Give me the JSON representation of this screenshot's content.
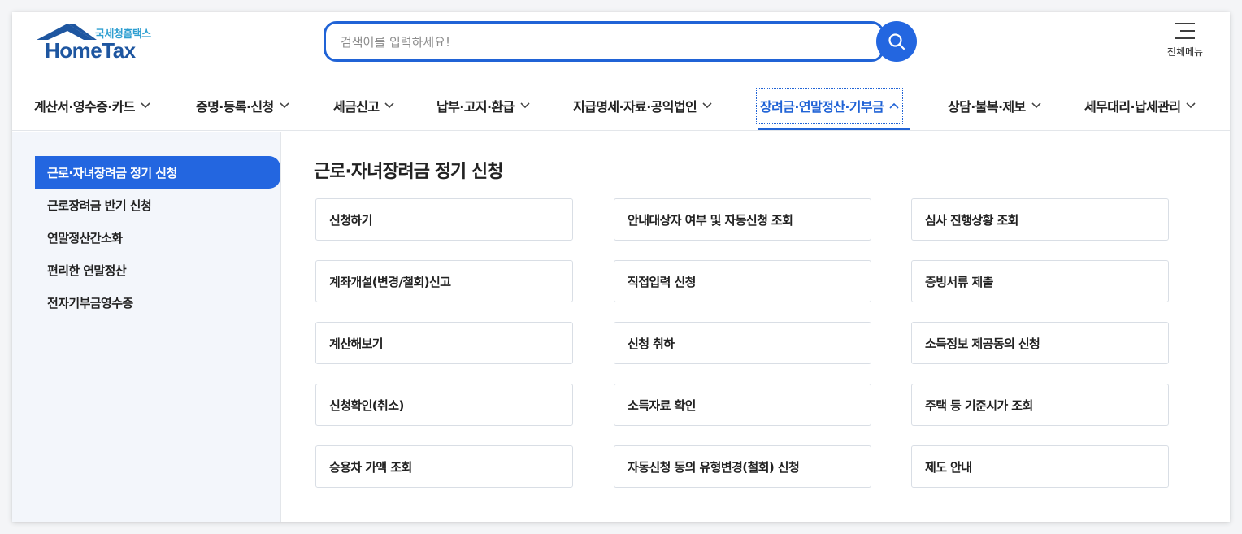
{
  "brand": {
    "sub": "국세청홈택스",
    "main": "HomeTax"
  },
  "search": {
    "placeholder": "검색어를 입력하세요!"
  },
  "menu_all_label": "전체메뉴",
  "gnb": [
    {
      "label": "계산서·영수증·카드",
      "expanded": false
    },
    {
      "label": "증명·등록·신청",
      "expanded": false
    },
    {
      "label": "세금신고",
      "expanded": false
    },
    {
      "label": "납부·고지·환급",
      "expanded": false
    },
    {
      "label": "지급명세·자료·공익법인",
      "expanded": false
    },
    {
      "label": "장려금·연말정산·기부금",
      "expanded": true
    },
    {
      "label": "상담·불복·제보",
      "expanded": false
    },
    {
      "label": "세무대리·납세관리",
      "expanded": false
    }
  ],
  "sidebar": [
    {
      "label": "근로·자녀장려금 정기 신청",
      "active": true
    },
    {
      "label": "근로장려금 반기 신청",
      "active": false
    },
    {
      "label": "연말정산간소화",
      "active": false
    },
    {
      "label": "편리한 연말정산",
      "active": false
    },
    {
      "label": "전자기부금영수증",
      "active": false
    }
  ],
  "content": {
    "title": "근로·자녀장려금 정기 신청",
    "cards": [
      [
        "신청하기",
        "안내대상자 여부 및 자동신청 조회",
        "심사 진행상황 조회"
      ],
      [
        "계좌개설(변경/철회)신고",
        "직접입력 신청",
        "증빙서류 제출"
      ],
      [
        "계산해보기",
        "신청 취하",
        "소득정보 제공동의 신청"
      ],
      [
        "신청확인(취소)",
        "소득자료 확인",
        "주택 등 기준시가 조회"
      ],
      [
        "승용차 가액 조회",
        "자동신청 동의 유형변경(철회) 신청",
        "제도 안내"
      ]
    ]
  },
  "colors": {
    "accent": "#2366e0",
    "brand_blue": "#1e56a0",
    "brand_sub": "#2f9fd1"
  },
  "icons": {
    "search": "search-icon",
    "menu": "hamburger-icon",
    "chevron": "chevron-icon"
  }
}
